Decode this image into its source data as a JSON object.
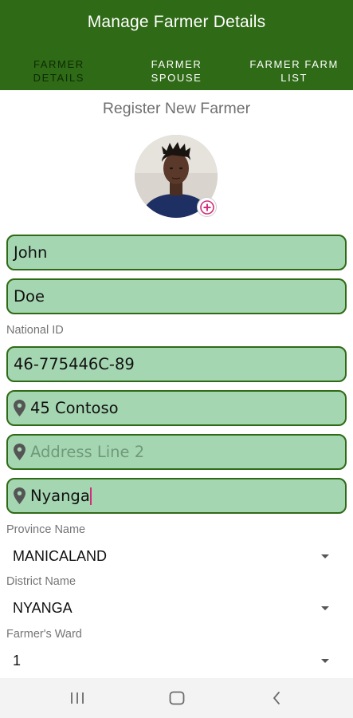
{
  "header": {
    "title": "Manage Farmer Details",
    "tabs": [
      {
        "label": "FARMER\nDETAILS"
      },
      {
        "label": "FARMER\nSPOUSE"
      },
      {
        "label": "FARMER FARM\nLIST"
      }
    ]
  },
  "form": {
    "section_title": "Register New Farmer",
    "first_name": "John",
    "last_name": "Doe",
    "national_id_label": "National ID",
    "national_id": "46-775446C-89",
    "address_line_1": "45 Contoso",
    "address_line_2_placeholder": "Address Line 2",
    "city": "Nyanga",
    "province_label": "Province Name",
    "province": "MANICALAND",
    "district_label": "District Name",
    "district": "NYANGA",
    "ward_label": "Farmer's Ward",
    "ward": "1"
  },
  "icons": {
    "add_photo": "plus-circle-icon",
    "location": "map-pin-icon",
    "dropdown": "caret-down-icon",
    "nav_recents": "recent-apps-icon",
    "nav_home": "home-icon",
    "nav_back": "back-icon"
  },
  "colors": {
    "header_bg": "#2f6a16",
    "field_bg": "#a5d6b2",
    "field_border": "#2f6a16",
    "accent_pink": "#d0307a"
  }
}
